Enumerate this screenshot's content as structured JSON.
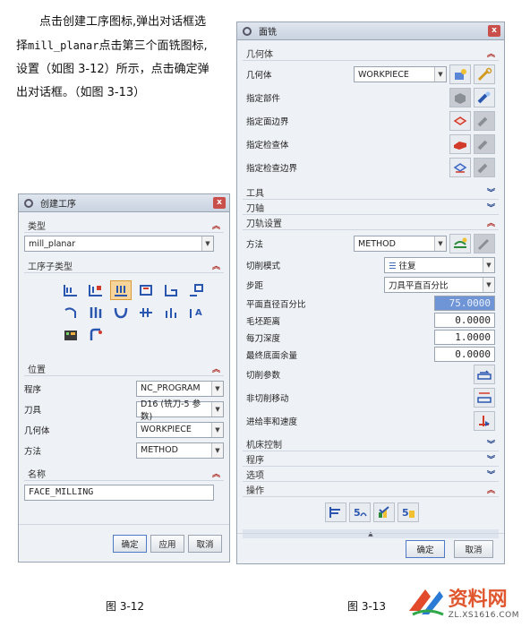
{
  "intro": {
    "line1": "点击创建工序图标,弹出对话框选",
    "line2_pre": "择",
    "line2_code": "mill_planar",
    "line2_post": "点击第三个面铣图标,",
    "line3": "设置（如图 3-12）所示，点击确定弹",
    "line4": "出对话框。（如图 3-13）"
  },
  "dialog1": {
    "title": "创建工序",
    "type_section": "类型",
    "type_value": "mill_planar",
    "subtype_section": "工序子类型",
    "subtype_icons": [
      "floor-wall-icon",
      "floor-wall-ipw-icon",
      "face-milling-icon",
      "face-milling-area-icon",
      "planar-mill-icon",
      "planar-profile-icon",
      "clean-corners-icon",
      "finish-walls-icon",
      "finish-floor-icon",
      "groove-milling-icon",
      "hole-milling-icon",
      "planar-text-icon",
      "mill-control-icon",
      "mill-user-icon"
    ],
    "location_section": "位置",
    "program_label": "程序",
    "program_value": "NC_PROGRAM",
    "tool_label": "刀具",
    "tool_value": "D16 (铣刀-5 参数)",
    "geometry_label": "几何体",
    "geometry_value": "WORKPIECE",
    "method_label": "方法",
    "method_value": "METHOD",
    "name_section": "名称",
    "name_value": "FACE_MILLING",
    "ok": "确定",
    "apply": "应用",
    "cancel": "取消"
  },
  "dialog2": {
    "title": "面铣",
    "geometry_section": "几何体",
    "geometry_label": "几何体",
    "geometry_value": "WORKPIECE",
    "specify_part": "指定部件",
    "specify_face": "指定面边界",
    "specify_check": "指定检查体",
    "specify_check_boundary": "指定检查边界",
    "tool_section": "工具",
    "axis_section": "刀轴",
    "path_section": "刀轨设置",
    "method_label": "方法",
    "method_value": "METHOD",
    "cut_pattern_label": "切削模式",
    "cut_pattern_value": "往复",
    "stepover_label": "步距",
    "stepover_value": "刀具平直百分比",
    "percent_label": "平面直径百分比",
    "percent_value": "75.0000",
    "blank_label": "毛坯距离",
    "blank_value": "0.0000",
    "depth_label": "每刀深度",
    "depth_value": "1.0000",
    "floor_label": "最终底面余量",
    "floor_value": "0.0000",
    "cut_params": "切削参数",
    "noncut": "非切削移动",
    "feeds": "进给率和速度",
    "machine_section": "机床控制",
    "program_section": "程序",
    "options_section": "选项",
    "actions_section": "操作",
    "ok": "确定",
    "cancel": "取消"
  },
  "captions": {
    "fig12": "图 3-12",
    "fig13": "图 3-13"
  },
  "watermark": {
    "brand": "资料网",
    "url": "ZL.XS1616.COM"
  },
  "colors": {
    "accent_blue": "#4d79c7",
    "chevron_red": "#b0322a",
    "highlight": "#6f95d6"
  }
}
